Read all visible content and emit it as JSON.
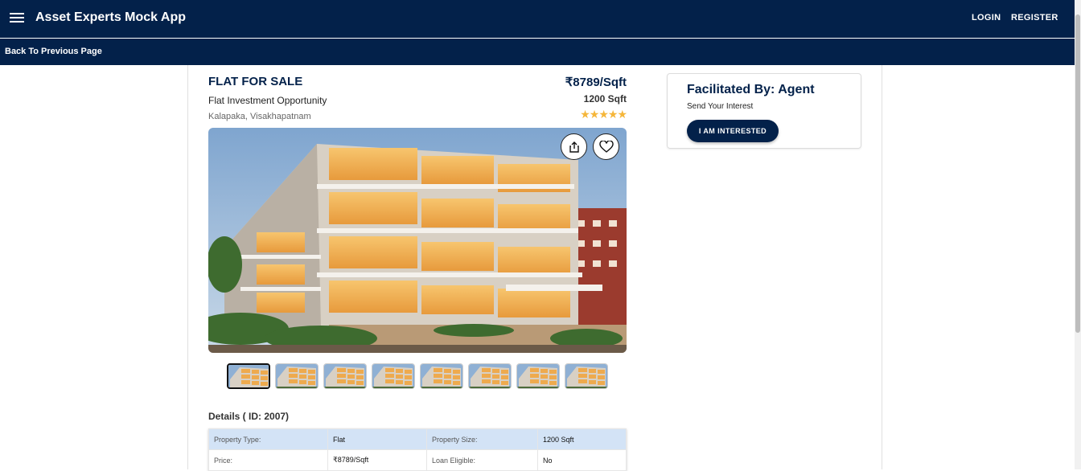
{
  "app": {
    "title": "Asset Experts Mock App"
  },
  "nav": {
    "login": "LOGIN",
    "register": "REGISTER",
    "back": "Back To Previous Page"
  },
  "property": {
    "title": "FLAT FOR SALE",
    "subtitle": "Flat Investment Opportunity",
    "location": "Kalapaka, Visakhapatnam",
    "price": "₹8789/Sqft",
    "size": "1200 Sqft",
    "stars": "★★★★★",
    "rating": 5,
    "thumbnail_count": 8,
    "active_thumbnail": 1
  },
  "details": {
    "heading": "Details ( ID: 2007)",
    "rows": [
      [
        "Property Type:",
        "Flat",
        "Property Size:",
        "1200 Sqft"
      ],
      [
        "Price:",
        "₹8789/Sqft",
        "Loan Eligible:",
        "No"
      ]
    ]
  },
  "agent": {
    "title": "Facilitated By: Agent",
    "subtitle": "Send Your Interest",
    "button": "I AM INTERESTED"
  },
  "colors": {
    "primary": "#03214a",
    "star": "#f5b63a",
    "table_header": "#d3e3f6"
  },
  "icons": [
    "menu-icon",
    "share-icon",
    "heart-icon"
  ]
}
